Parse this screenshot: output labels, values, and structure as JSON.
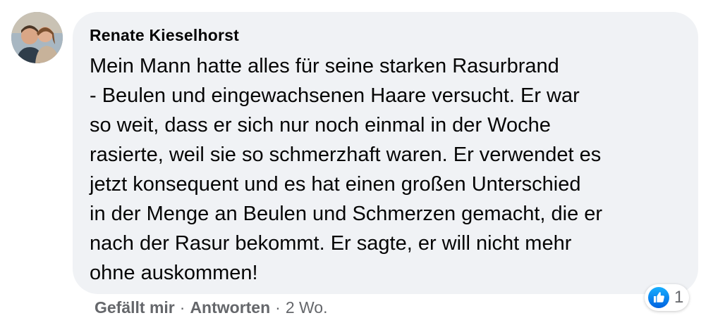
{
  "comment": {
    "author": "Renate Kieselhorst",
    "text": "Mein Mann hatte alles für seine starken Rasurbrand\n- Beulen und eingewachsenen Haare versucht. Er war\nso weit, dass er sich nur noch einmal in der Woche\nrasierte, weil sie so schmerzhaft waren. Er verwendet es\njetzt konsequent und es hat einen großen Unterschied\nin der Menge an Beulen und Schmerzen gemacht, die er\nnach der Rasur bekommt. Er sagte, er will nicht mehr\nohne auskommen!",
    "reactions": {
      "icon": "like-icon",
      "count": "1",
      "color": "#1877f2"
    },
    "actions": {
      "like_label": "Gefällt mir",
      "reply_label": "Antworten",
      "separator": "·",
      "timestamp": "2 Wo."
    }
  },
  "colors": {
    "bubble_background": "#f0f2f5",
    "text": "#050505",
    "secondary_text": "#65676b"
  }
}
